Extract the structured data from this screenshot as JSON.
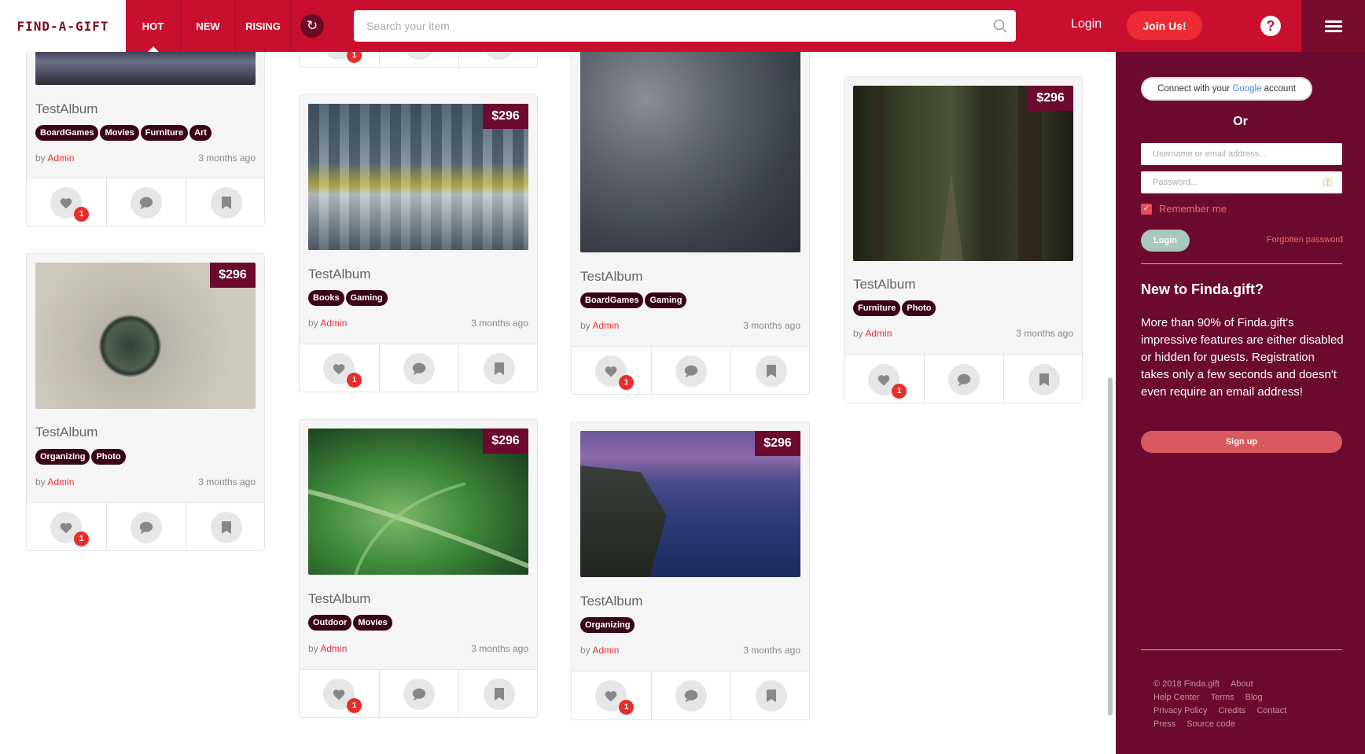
{
  "header": {
    "logo": "FIND-A-GIFT",
    "tabs": [
      "HOT",
      "NEW",
      "RISING"
    ],
    "search_placeholder": "Search your item",
    "login": "Login",
    "join": "Join Us!",
    "help": "?"
  },
  "sidebar": {
    "google_prefix": "Connect with your ",
    "google_word": "Google",
    "google_suffix": " account",
    "or": "Or",
    "username_placeholder": "Username or email address...",
    "password_placeholder": "Password...",
    "remember": "Remember me",
    "login_button": "Login",
    "forgot": "Forgotten password",
    "new_heading": "New to Finda.gift?",
    "description": "More than 90% of Finda.gift's impressive features are either disabled or hidden for guests. Registration takes only a few seconds and doesn't even require an email address!",
    "signup": "Sign up",
    "footer": {
      "row1": [
        "© 2018 Finda.gift",
        "About"
      ],
      "row2": [
        "Help Center",
        "Terms",
        "Blog"
      ],
      "row3": [
        "Privacy Policy",
        "Credits",
        "Contact"
      ],
      "row4": [
        "Press",
        "Source code"
      ]
    }
  },
  "cards": [
    {
      "title": "TestAlbum",
      "tags": [
        "BoardGames",
        "Movies",
        "Furniture",
        "Art"
      ],
      "author_prefix": "by ",
      "author": "Admin",
      "time": "3 months ago",
      "likes": "1"
    },
    {
      "title": "TestAlbum",
      "price": "$296",
      "tags": [
        "Organizing",
        "Photo"
      ],
      "author_prefix": "by ",
      "author": "Admin",
      "time": "3 months ago",
      "likes": "1"
    },
    {
      "likes": "1"
    },
    {
      "title": "TestAlbum",
      "price": "$296",
      "tags": [
        "Books",
        "Gaming"
      ],
      "author_prefix": "by ",
      "author": "Admin",
      "time": "3 months ago",
      "likes": "1"
    },
    {
      "title": "TestAlbum",
      "price": "$296",
      "tags": [
        "Outdoor",
        "Movies"
      ],
      "author_prefix": "by ",
      "author": "Admin",
      "time": "3 months ago",
      "likes": "1"
    },
    {
      "title": "TestAlbum",
      "tags": [
        "BoardGames",
        "Gaming"
      ],
      "author_prefix": "by ",
      "author": "Admin",
      "time": "3 months ago",
      "likes": "1"
    },
    {
      "title": "TestAlbum",
      "price": "$296",
      "tags": [
        "Organizing"
      ],
      "author_prefix": "by ",
      "author": "Admin",
      "time": "3 months ago",
      "likes": "1"
    },
    {
      "title": "TestAlbum",
      "price": "$296",
      "tags": [
        "Furniture",
        "Photo"
      ],
      "author_prefix": "by ",
      "author": "Admin",
      "time": "3 months ago",
      "likes": "1"
    }
  ],
  "colors": {
    "primary": "#c8102e",
    "sidebar": "#6b0a2e",
    "tag": "#3a0318",
    "link": "#e8323c"
  }
}
